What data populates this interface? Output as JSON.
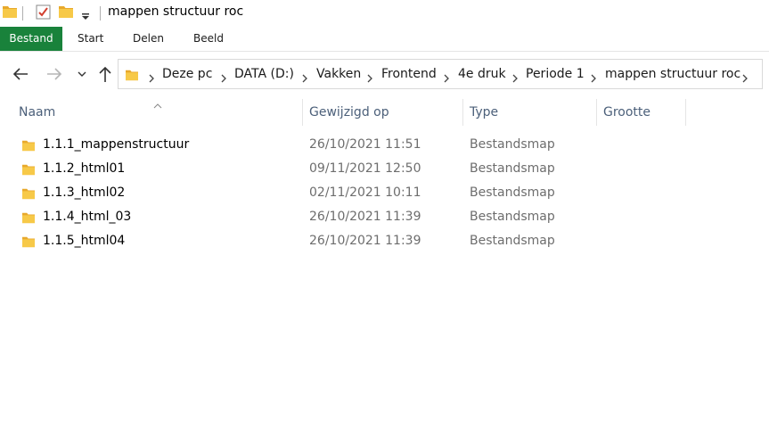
{
  "window": {
    "title": "mappen structuur roc"
  },
  "ribbon": {
    "tabs": [
      {
        "label": "Bestand",
        "active": true
      },
      {
        "label": "Start"
      },
      {
        "label": "Delen"
      },
      {
        "label": "Beeld"
      }
    ],
    "file_tab_color": "#19823b"
  },
  "navigation": {
    "icons": [
      "back-arrow-icon",
      "forward-arrow-icon",
      "recent-locations-chevron-icon",
      "up-arrow-icon"
    ],
    "breadcrumb": [
      "Deze pc",
      "DATA (D:)",
      "Vakken",
      "Frontend",
      "4e druk",
      "Periode 1",
      "mappen structuur roc"
    ]
  },
  "columns": {
    "name": "Naam",
    "modified": "Gewijzigd op",
    "type": "Type",
    "size": "Grootte"
  },
  "files": [
    {
      "name": "1.1.1_mappenstructuur",
      "modified": "26/10/2021 11:51",
      "type": "Bestandsmap",
      "size": ""
    },
    {
      "name": "1.1.2_html01",
      "modified": "09/11/2021 12:50",
      "type": "Bestandsmap",
      "size": ""
    },
    {
      "name": "1.1.3_html02",
      "modified": "02/11/2021 10:11",
      "type": "Bestandsmap",
      "size": ""
    },
    {
      "name": "1.1.4_html_03",
      "modified": "26/10/2021 11:39",
      "type": "Bestandsmap",
      "size": ""
    },
    {
      "name": "1.1.5_html04",
      "modified": "26/10/2021 11:39",
      "type": "Bestandsmap",
      "size": ""
    }
  ],
  "colors": {
    "folder": "#f7c948",
    "folder_dark": "#e8a92c",
    "header_text": "#4c607a",
    "secondary_text": "#6d6d6d"
  }
}
